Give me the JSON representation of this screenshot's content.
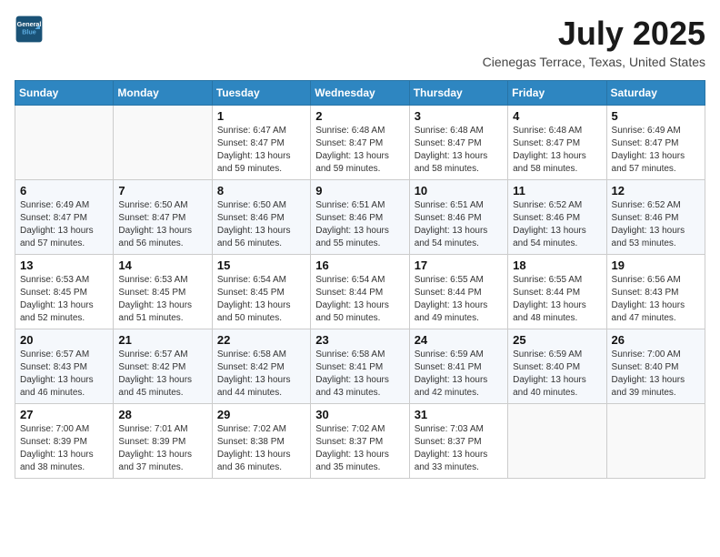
{
  "header": {
    "logo": {
      "line1": "General",
      "line2": "Blue"
    },
    "title": "July 2025",
    "subtitle": "Cienegas Terrace, Texas, United States"
  },
  "weekdays": [
    "Sunday",
    "Monday",
    "Tuesday",
    "Wednesday",
    "Thursday",
    "Friday",
    "Saturday"
  ],
  "weeks": [
    [
      {
        "day": "",
        "sunrise": "",
        "sunset": "",
        "daylight": ""
      },
      {
        "day": "",
        "sunrise": "",
        "sunset": "",
        "daylight": ""
      },
      {
        "day": "1",
        "sunrise": "Sunrise: 6:47 AM",
        "sunset": "Sunset: 8:47 PM",
        "daylight": "Daylight: 13 hours and 59 minutes."
      },
      {
        "day": "2",
        "sunrise": "Sunrise: 6:48 AM",
        "sunset": "Sunset: 8:47 PM",
        "daylight": "Daylight: 13 hours and 59 minutes."
      },
      {
        "day": "3",
        "sunrise": "Sunrise: 6:48 AM",
        "sunset": "Sunset: 8:47 PM",
        "daylight": "Daylight: 13 hours and 58 minutes."
      },
      {
        "day": "4",
        "sunrise": "Sunrise: 6:48 AM",
        "sunset": "Sunset: 8:47 PM",
        "daylight": "Daylight: 13 hours and 58 minutes."
      },
      {
        "day": "5",
        "sunrise": "Sunrise: 6:49 AM",
        "sunset": "Sunset: 8:47 PM",
        "daylight": "Daylight: 13 hours and 57 minutes."
      }
    ],
    [
      {
        "day": "6",
        "sunrise": "Sunrise: 6:49 AM",
        "sunset": "Sunset: 8:47 PM",
        "daylight": "Daylight: 13 hours and 57 minutes."
      },
      {
        "day": "7",
        "sunrise": "Sunrise: 6:50 AM",
        "sunset": "Sunset: 8:47 PM",
        "daylight": "Daylight: 13 hours and 56 minutes."
      },
      {
        "day": "8",
        "sunrise": "Sunrise: 6:50 AM",
        "sunset": "Sunset: 8:46 PM",
        "daylight": "Daylight: 13 hours and 56 minutes."
      },
      {
        "day": "9",
        "sunrise": "Sunrise: 6:51 AM",
        "sunset": "Sunset: 8:46 PM",
        "daylight": "Daylight: 13 hours and 55 minutes."
      },
      {
        "day": "10",
        "sunrise": "Sunrise: 6:51 AM",
        "sunset": "Sunset: 8:46 PM",
        "daylight": "Daylight: 13 hours and 54 minutes."
      },
      {
        "day": "11",
        "sunrise": "Sunrise: 6:52 AM",
        "sunset": "Sunset: 8:46 PM",
        "daylight": "Daylight: 13 hours and 54 minutes."
      },
      {
        "day": "12",
        "sunrise": "Sunrise: 6:52 AM",
        "sunset": "Sunset: 8:46 PM",
        "daylight": "Daylight: 13 hours and 53 minutes."
      }
    ],
    [
      {
        "day": "13",
        "sunrise": "Sunrise: 6:53 AM",
        "sunset": "Sunset: 8:45 PM",
        "daylight": "Daylight: 13 hours and 52 minutes."
      },
      {
        "day": "14",
        "sunrise": "Sunrise: 6:53 AM",
        "sunset": "Sunset: 8:45 PM",
        "daylight": "Daylight: 13 hours and 51 minutes."
      },
      {
        "day": "15",
        "sunrise": "Sunrise: 6:54 AM",
        "sunset": "Sunset: 8:45 PM",
        "daylight": "Daylight: 13 hours and 50 minutes."
      },
      {
        "day": "16",
        "sunrise": "Sunrise: 6:54 AM",
        "sunset": "Sunset: 8:44 PM",
        "daylight": "Daylight: 13 hours and 50 minutes."
      },
      {
        "day": "17",
        "sunrise": "Sunrise: 6:55 AM",
        "sunset": "Sunset: 8:44 PM",
        "daylight": "Daylight: 13 hours and 49 minutes."
      },
      {
        "day": "18",
        "sunrise": "Sunrise: 6:55 AM",
        "sunset": "Sunset: 8:44 PM",
        "daylight": "Daylight: 13 hours and 48 minutes."
      },
      {
        "day": "19",
        "sunrise": "Sunrise: 6:56 AM",
        "sunset": "Sunset: 8:43 PM",
        "daylight": "Daylight: 13 hours and 47 minutes."
      }
    ],
    [
      {
        "day": "20",
        "sunrise": "Sunrise: 6:57 AM",
        "sunset": "Sunset: 8:43 PM",
        "daylight": "Daylight: 13 hours and 46 minutes."
      },
      {
        "day": "21",
        "sunrise": "Sunrise: 6:57 AM",
        "sunset": "Sunset: 8:42 PM",
        "daylight": "Daylight: 13 hours and 45 minutes."
      },
      {
        "day": "22",
        "sunrise": "Sunrise: 6:58 AM",
        "sunset": "Sunset: 8:42 PM",
        "daylight": "Daylight: 13 hours and 44 minutes."
      },
      {
        "day": "23",
        "sunrise": "Sunrise: 6:58 AM",
        "sunset": "Sunset: 8:41 PM",
        "daylight": "Daylight: 13 hours and 43 minutes."
      },
      {
        "day": "24",
        "sunrise": "Sunrise: 6:59 AM",
        "sunset": "Sunset: 8:41 PM",
        "daylight": "Daylight: 13 hours and 42 minutes."
      },
      {
        "day": "25",
        "sunrise": "Sunrise: 6:59 AM",
        "sunset": "Sunset: 8:40 PM",
        "daylight": "Daylight: 13 hours and 40 minutes."
      },
      {
        "day": "26",
        "sunrise": "Sunrise: 7:00 AM",
        "sunset": "Sunset: 8:40 PM",
        "daylight": "Daylight: 13 hours and 39 minutes."
      }
    ],
    [
      {
        "day": "27",
        "sunrise": "Sunrise: 7:00 AM",
        "sunset": "Sunset: 8:39 PM",
        "daylight": "Daylight: 13 hours and 38 minutes."
      },
      {
        "day": "28",
        "sunrise": "Sunrise: 7:01 AM",
        "sunset": "Sunset: 8:39 PM",
        "daylight": "Daylight: 13 hours and 37 minutes."
      },
      {
        "day": "29",
        "sunrise": "Sunrise: 7:02 AM",
        "sunset": "Sunset: 8:38 PM",
        "daylight": "Daylight: 13 hours and 36 minutes."
      },
      {
        "day": "30",
        "sunrise": "Sunrise: 7:02 AM",
        "sunset": "Sunset: 8:37 PM",
        "daylight": "Daylight: 13 hours and 35 minutes."
      },
      {
        "day": "31",
        "sunrise": "Sunrise: 7:03 AM",
        "sunset": "Sunset: 8:37 PM",
        "daylight": "Daylight: 13 hours and 33 minutes."
      },
      {
        "day": "",
        "sunrise": "",
        "sunset": "",
        "daylight": ""
      },
      {
        "day": "",
        "sunrise": "",
        "sunset": "",
        "daylight": ""
      }
    ]
  ]
}
